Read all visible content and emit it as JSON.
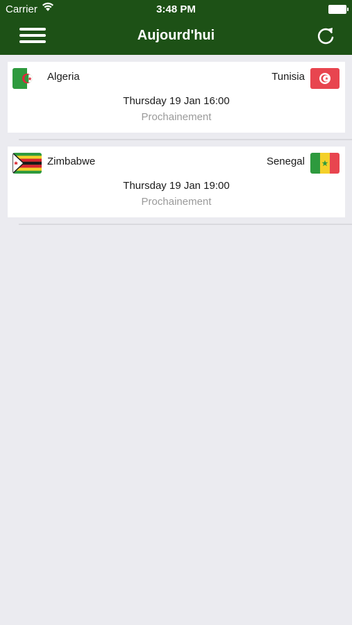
{
  "status_bar": {
    "carrier": "Carrier",
    "time": "3:48 PM"
  },
  "nav": {
    "title": "Aujourd'hui",
    "menu_icon": "hamburger-menu-icon",
    "refresh_icon": "refresh-icon"
  },
  "colors": {
    "header_bg": "#1d5116",
    "page_bg": "#ebebf0",
    "status_text": "#9a9a9a"
  },
  "matches": [
    {
      "home_team": "Algeria",
      "away_team": "Tunisia",
      "datetime": "Thursday 19 Jan 16:00",
      "status": "Prochainement",
      "home_flag": "algeria-flag-icon",
      "away_flag": "tunisia-flag-icon"
    },
    {
      "home_team": "Zimbabwe",
      "away_team": "Senegal",
      "datetime": "Thursday 19 Jan 19:00",
      "status": "Prochainement",
      "home_flag": "zimbabwe-flag-icon",
      "away_flag": "senegal-flag-icon"
    }
  ]
}
